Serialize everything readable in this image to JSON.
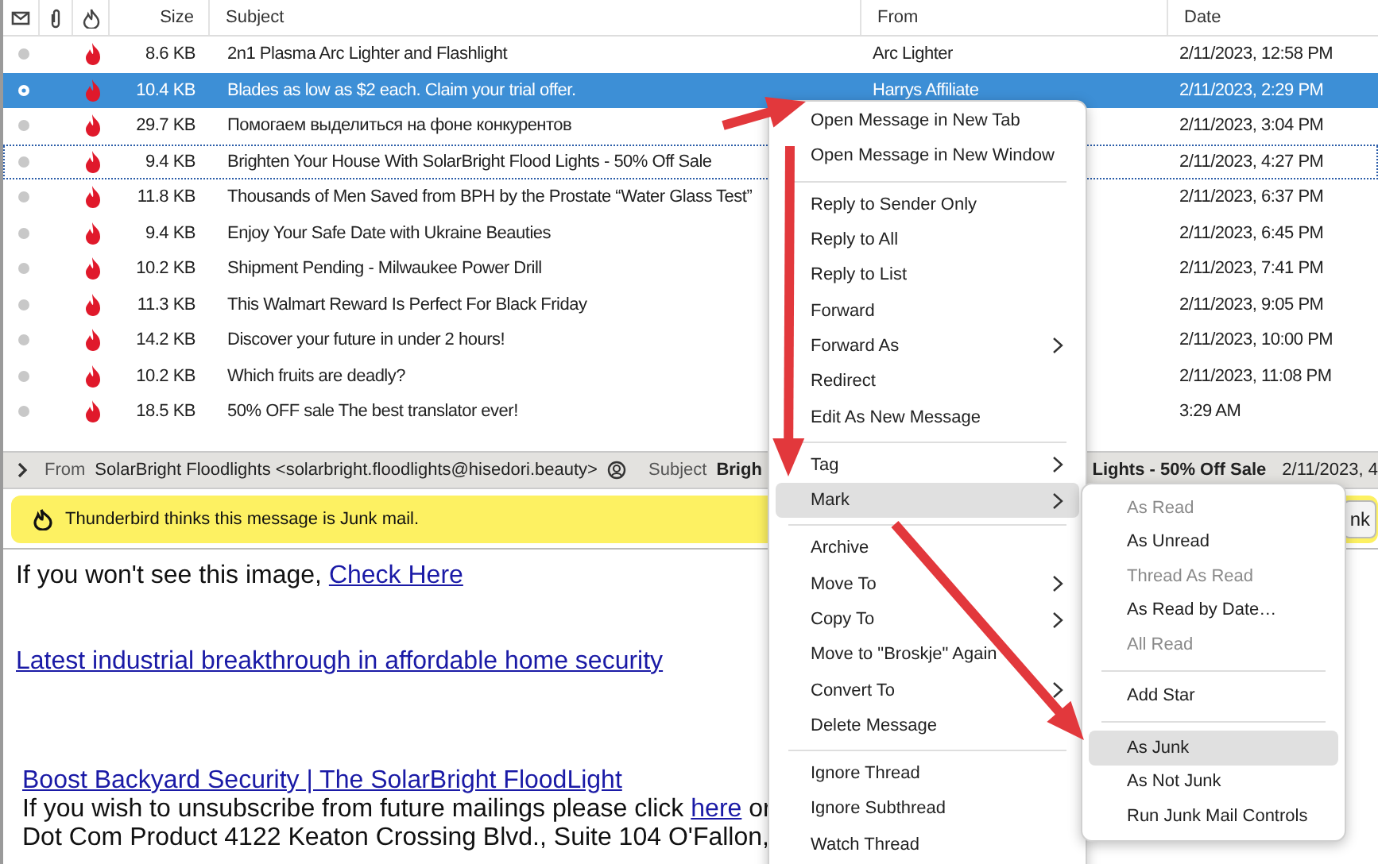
{
  "thread_pane": {
    "columns": [
      "Size",
      "Subject",
      "From",
      "Date"
    ],
    "rows": [
      {
        "size": "8.6 KB",
        "subject": "2n1 Plasma Arc Lighter and Flashlight",
        "from": "Arc Lighter",
        "date": "2/11/2023, 12:58 PM",
        "junk": true,
        "selected": false,
        "focused": false
      },
      {
        "size": "10.4 KB",
        "subject": "Blades as low as $2 each. Claim your trial offer.",
        "from": "Harrys Affiliate",
        "date": "2/11/2023, 2:29 PM",
        "junk": true,
        "selected": true,
        "focused": false
      },
      {
        "size": "29.7 KB",
        "subject": "Помогаем выделиться на фоне конкурентов",
        "date": "2/11/2023, 3:04 PM",
        "junk": true,
        "selected": false,
        "focused": false
      },
      {
        "size": "9.4 KB",
        "subject": "Brighten Your House With SolarBright Flood Lights - 50% Off Sale",
        "date": "2/11/2023, 4:27 PM",
        "junk": true,
        "selected": false,
        "focused": true
      },
      {
        "size": "11.8 KB",
        "subject": "Thousands of Men Saved from BPH by the Prostate “Water Glass Test”",
        "date": "2/11/2023, 6:37 PM",
        "junk": true,
        "selected": false,
        "focused": false
      },
      {
        "size": "9.4 KB",
        "subject": "Enjoy Your Safe Date with Ukraine Beauties",
        "date": "2/11/2023, 6:45 PM",
        "junk": true,
        "selected": false,
        "focused": false
      },
      {
        "size": "10.2 KB",
        "subject": "Shipment Pending - Milwaukee Power Drill",
        "date": "2/11/2023, 7:41 PM",
        "junk": true,
        "selected": false,
        "focused": false
      },
      {
        "size": "11.3 KB",
        "subject": "This Walmart Reward Is Perfect For Black Friday",
        "date": "2/11/2023, 9:05 PM",
        "junk": true,
        "selected": false,
        "focused": false
      },
      {
        "size": "14.2 KB",
        "subject": "Discover your future in under 2 hours!",
        "date": "2/11/2023, 10:00 PM",
        "junk": true,
        "selected": false,
        "focused": false
      },
      {
        "size": "10.2 KB",
        "subject": "Which fruits are deadly?",
        "date": "2/11/2023, 11:08 PM",
        "junk": true,
        "selected": false,
        "focused": false
      },
      {
        "size": "18.5 KB",
        "subject": "50% OFF sale The best translator ever!",
        "date": "3:29 AM",
        "junk": true,
        "selected": false,
        "focused": false
      }
    ]
  },
  "message_header": {
    "from_label": "From",
    "from": "SolarBright Floodlights <solarbright.floodlights@hisedori.beauty>",
    "subject_label": "Subject",
    "subject_start": "Brigh",
    "subject_end": "Lights - 50% Off Sale",
    "date": "2/11/2023, 4"
  },
  "junk_bar": {
    "message": "Thunderbird thinks this message is Junk mail.",
    "button": "nk"
  },
  "message_body": [
    {
      "text": "If you won't see this image,",
      "link": "Check Here"
    },
    {
      "link": "Latest industrial breakthrough in affordable home security"
    },
    {
      "link": "Boost Backyard Security | The SolarBright FloodLight"
    },
    {
      "text": "If you wish to unsubscribe from future mailings please click",
      "link": "here",
      "after": "or"
    },
    {
      "text": "Dot Com Product 4122 Keaton Crossing Blvd., Suite 104 O'Fallon,"
    }
  ],
  "context_menu": [
    {
      "kind": "item",
      "label": "Open Message in New Tab",
      "submenu": false,
      "highlighted": false
    },
    {
      "kind": "item",
      "label": "Open Message in New Window",
      "submenu": false,
      "highlighted": false
    },
    {
      "kind": "separator"
    },
    {
      "kind": "item",
      "label": "Reply to Sender Only",
      "submenu": false,
      "highlighted": false
    },
    {
      "kind": "item",
      "label": "Reply to All",
      "submenu": false,
      "highlighted": false
    },
    {
      "kind": "item",
      "label": "Reply to List",
      "submenu": false,
      "highlighted": false
    },
    {
      "kind": "item",
      "label": "Forward",
      "submenu": false,
      "highlighted": false
    },
    {
      "kind": "item",
      "label": "Forward As",
      "submenu": true,
      "highlighted": false
    },
    {
      "kind": "item",
      "label": "Redirect",
      "submenu": false,
      "highlighted": false
    },
    {
      "kind": "item",
      "label": "Edit As New Message",
      "submenu": false,
      "highlighted": false
    },
    {
      "kind": "separator"
    },
    {
      "kind": "item",
      "label": "Tag",
      "submenu": true,
      "highlighted": false
    },
    {
      "kind": "item",
      "label": "Mark",
      "submenu": true,
      "highlighted": true
    },
    {
      "kind": "separator"
    },
    {
      "kind": "item",
      "label": "Archive",
      "submenu": false,
      "highlighted": false
    },
    {
      "kind": "item",
      "label": "Move To",
      "submenu": true,
      "highlighted": false
    },
    {
      "kind": "item",
      "label": "Copy To",
      "submenu": true,
      "highlighted": false
    },
    {
      "kind": "item",
      "label": "Move to \"Broskje\" Again",
      "submenu": false,
      "highlighted": false
    },
    {
      "kind": "item",
      "label": "Convert To",
      "submenu": true,
      "highlighted": false
    },
    {
      "kind": "item",
      "label": "Delete Message",
      "submenu": false,
      "highlighted": false
    },
    {
      "kind": "separator"
    },
    {
      "kind": "item",
      "label": "Ignore Thread",
      "submenu": false,
      "highlighted": false
    },
    {
      "kind": "item",
      "label": "Ignore Subthread",
      "submenu": false,
      "highlighted": false
    },
    {
      "kind": "item",
      "label": "Watch Thread",
      "submenu": false,
      "highlighted": false
    }
  ],
  "mark_submenu": [
    {
      "kind": "item",
      "label": "As Read",
      "disabled": true,
      "highlighted": false
    },
    {
      "kind": "item",
      "label": "As Unread",
      "disabled": false,
      "highlighted": false
    },
    {
      "kind": "item",
      "label": "Thread As Read",
      "disabled": true,
      "highlighted": false
    },
    {
      "kind": "item",
      "label": "As Read by Date…",
      "disabled": false,
      "highlighted": false
    },
    {
      "kind": "item",
      "label": "All Read",
      "disabled": true,
      "highlighted": false
    },
    {
      "kind": "separator"
    },
    {
      "kind": "item",
      "label": "Add Star",
      "disabled": false,
      "highlighted": false
    },
    {
      "kind": "separator"
    },
    {
      "kind": "item",
      "label": "As Junk",
      "disabled": false,
      "highlighted": true
    },
    {
      "kind": "item",
      "label": "As Not Junk",
      "disabled": false,
      "highlighted": false
    },
    {
      "kind": "item",
      "label": "Run Junk Mail Controls",
      "disabled": false,
      "highlighted": false
    }
  ]
}
